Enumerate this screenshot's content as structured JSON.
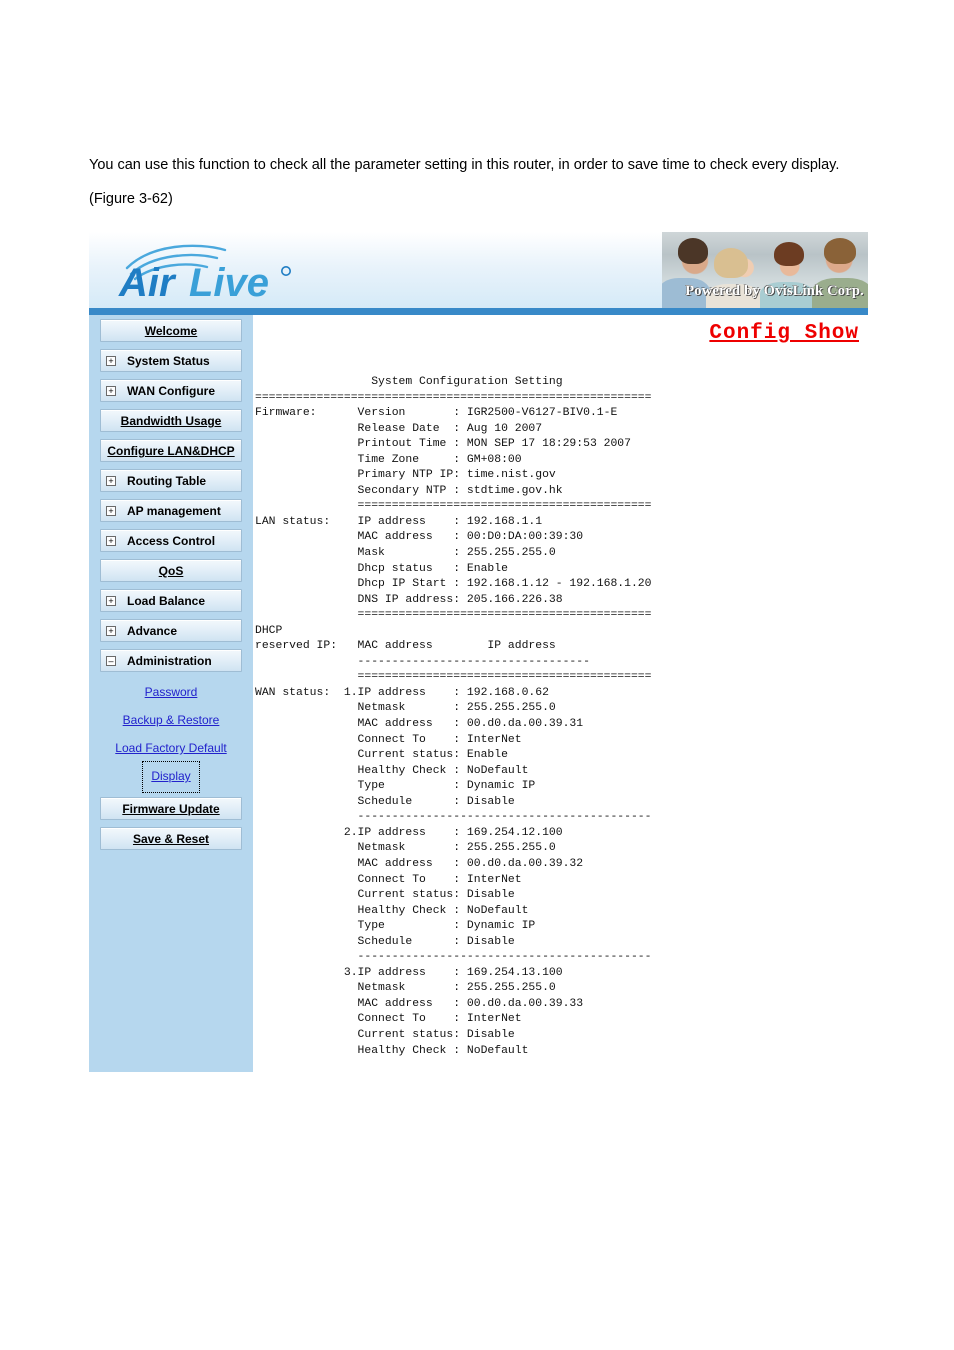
{
  "document": {
    "intro_paragraph": "You can use this function to check all the parameter setting in this router, in order to save time to check every display. (Figure 3-62)"
  },
  "header": {
    "logo_text": "Air Live",
    "powered_by": "Powered by OvisLink Corp.",
    "accent_blue": "#3889c8",
    "sidebar_blue": "#b6d7ee"
  },
  "sidebar": {
    "items": [
      {
        "label": "Welcome",
        "toggle": "",
        "has_toggle": false
      },
      {
        "label": "System Status",
        "toggle": "+",
        "has_toggle": true
      },
      {
        "label": "WAN Configure",
        "toggle": "+",
        "has_toggle": true
      },
      {
        "label": "Bandwidth Usage",
        "toggle": "",
        "has_toggle": false
      },
      {
        "label": "Configure LAN&DHCP",
        "toggle": "",
        "has_toggle": false
      },
      {
        "label": "Routing Table",
        "toggle": "+",
        "has_toggle": true
      },
      {
        "label": "AP management",
        "toggle": "+",
        "has_toggle": true
      },
      {
        "label": "Access Control",
        "toggle": "+",
        "has_toggle": true
      },
      {
        "label": "QoS",
        "toggle": "",
        "has_toggle": false
      },
      {
        "label": "Load Balance",
        "toggle": "+",
        "has_toggle": true
      },
      {
        "label": "Advance",
        "toggle": "+",
        "has_toggle": true
      },
      {
        "label": "Administration",
        "toggle": "–",
        "has_toggle": true
      }
    ],
    "sub_items": [
      {
        "label": "Password",
        "focused": false
      },
      {
        "label": "Backup & Restore",
        "focused": false
      },
      {
        "label": "Load Factory Default",
        "focused": false
      },
      {
        "label": "Display",
        "focused": true
      }
    ],
    "bottom_items": [
      {
        "label": "Firmware Update"
      },
      {
        "label": "Save & Reset"
      }
    ]
  },
  "content": {
    "page_title": "Config Show",
    "page_title_color": "#ee0000",
    "config_text": "                 System Configuration Setting\n==========================================================\nFirmware:      Version       : IGR2500-V6127-BIV0.1-E\n               Release Date  : Aug 10 2007\n               Printout Time : MON SEP 17 18:29:53 2007\n               Time Zone     : GM+08:00\n               Primary NTP IP: time.nist.gov\n               Secondary NTP : stdtime.gov.hk\n               ===========================================\nLAN status:    IP address    : 192.168.1.1\n               MAC address   : 00:D0:DA:00:39:30\n               Mask          : 255.255.255.0\n               Dhcp status   : Enable\n               Dhcp IP Start : 192.168.1.12 - 192.168.1.20\n               DNS IP address: 205.166.226.38\n               ===========================================\nDHCP\nreserved IP:   MAC address        IP address\n               ----------------------------------\n               ===========================================\nWAN status:  1.IP address    : 192.168.0.62\n               Netmask       : 255.255.255.0\n               MAC address   : 00.d0.da.00.39.31\n               Connect To    : InterNet\n               Current status: Enable\n               Healthy Check : NoDefault\n               Type          : Dynamic IP\n               Schedule      : Disable\n               -------------------------------------------\n             2.IP address    : 169.254.12.100\n               Netmask       : 255.255.255.0\n               MAC address   : 00.d0.da.00.39.32\n               Connect To    : InterNet\n               Current status: Disable\n               Healthy Check : NoDefault\n               Type          : Dynamic IP\n               Schedule      : Disable\n               -------------------------------------------\n             3.IP address    : 169.254.13.100\n               Netmask       : 255.255.255.0\n               MAC address   : 00.d0.da.00.39.33\n               Connect To    : InterNet\n               Current status: Disable\n               Healthy Check : NoDefault",
    "config_details": {
      "section_title": "System Configuration Setting",
      "firmware": {
        "label": "Firmware:",
        "Version": "IGR2500-V6127-BIV0.1-E",
        "Release Date": "Aug 10 2007",
        "Printout Time": "MON SEP 17 18:29:53 2007",
        "Time Zone": "GM+08:00",
        "Primary NTP IP": "time.nist.gov",
        "Secondary NTP": "stdtime.gov.hk"
      },
      "lan_status": {
        "label": "LAN status:",
        "IP address": "192.168.1.1",
        "MAC address": "00:D0:DA:00:39:30",
        "Mask": "255.255.255.0",
        "Dhcp status": "Enable",
        "Dhcp IP Start": "192.168.1.12 - 192.168.1.20",
        "DNS IP address": "205.166.226.38"
      },
      "dhcp_reserved_ip": {
        "label": "DHCP reserved IP:",
        "columns": [
          "MAC address",
          "IP address"
        ],
        "rows": []
      },
      "wan_status": {
        "label": "WAN status:",
        "entries": [
          {
            "index": "1",
            "IP address": "192.168.0.62",
            "Netmask": "255.255.255.0",
            "MAC address": "00.d0.da.00.39.31",
            "Connect To": "InterNet",
            "Current status": "Enable",
            "Healthy Check": "NoDefault",
            "Type": "Dynamic IP",
            "Schedule": "Disable"
          },
          {
            "index": "2",
            "IP address": "169.254.12.100",
            "Netmask": "255.255.255.0",
            "MAC address": "00.d0.da.00.39.32",
            "Connect To": "InterNet",
            "Current status": "Disable",
            "Healthy Check": "NoDefault",
            "Type": "Dynamic IP",
            "Schedule": "Disable"
          },
          {
            "index": "3",
            "IP address": "169.254.13.100",
            "Netmask": "255.255.255.0",
            "MAC address": "00.d0.da.00.39.33",
            "Connect To": "InterNet",
            "Current status": "Disable",
            "Healthy Check": "NoDefault"
          }
        ]
      }
    }
  }
}
